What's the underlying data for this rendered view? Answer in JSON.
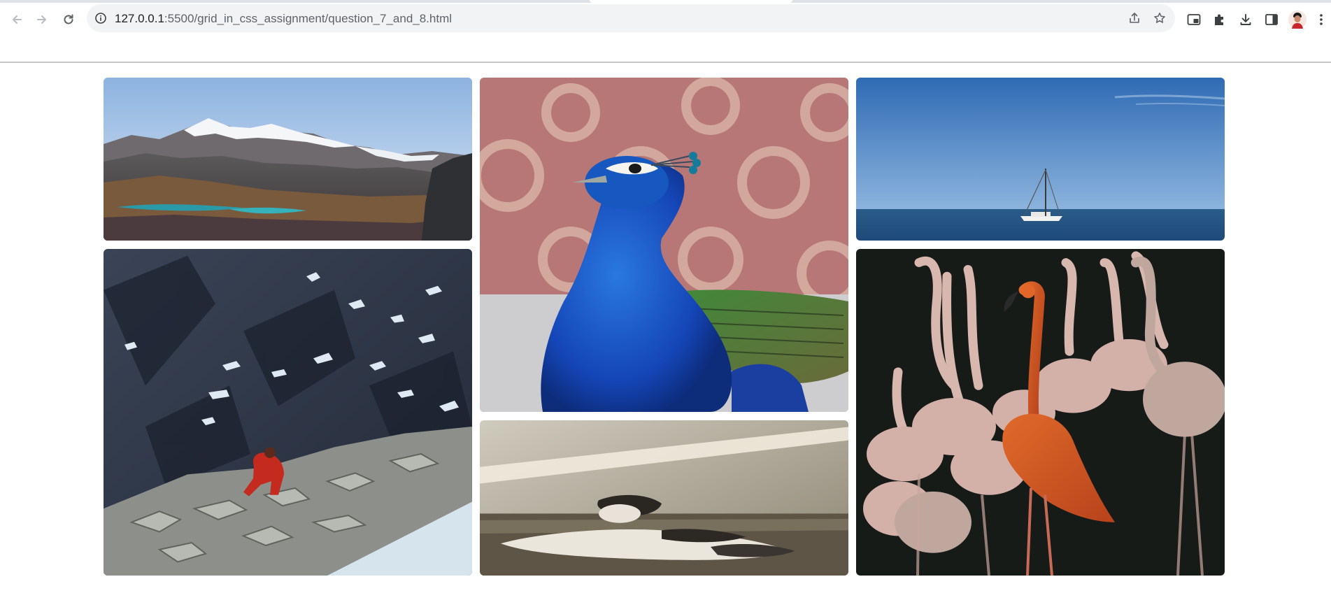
{
  "browser": {
    "url_host": "127.0.0.1",
    "url_rest": ":5500/grid_in_css_assignment/question_7_and_8.html",
    "nav": [
      "back-icon",
      "forward-icon",
      "reload-icon"
    ],
    "omnibox_icons": [
      "share-icon",
      "bookmark-star-icon"
    ],
    "toolbar_icons": [
      "picture-in-picture-icon",
      "extensions-icon",
      "download-icon",
      "side-panel-icon",
      "profile-avatar",
      "menu-icon"
    ]
  },
  "gallery": {
    "images": [
      {
        "name": "mountain-lake-photo",
        "subject": "snowy mountains with turquoise lake"
      },
      {
        "name": "peacock-photo",
        "subject": "blue peacock portrait"
      },
      {
        "name": "sailboat-photo",
        "subject": "sailboat on open sea"
      },
      {
        "name": "rock-climber-photo",
        "subject": "climber in red jacket on rocky slope"
      },
      {
        "name": "sleeping-cat-photo",
        "subject": "cat lying in sunlight"
      },
      {
        "name": "flamingos-photo",
        "subject": "orange flamingo among pale flamingos"
      }
    ]
  }
}
